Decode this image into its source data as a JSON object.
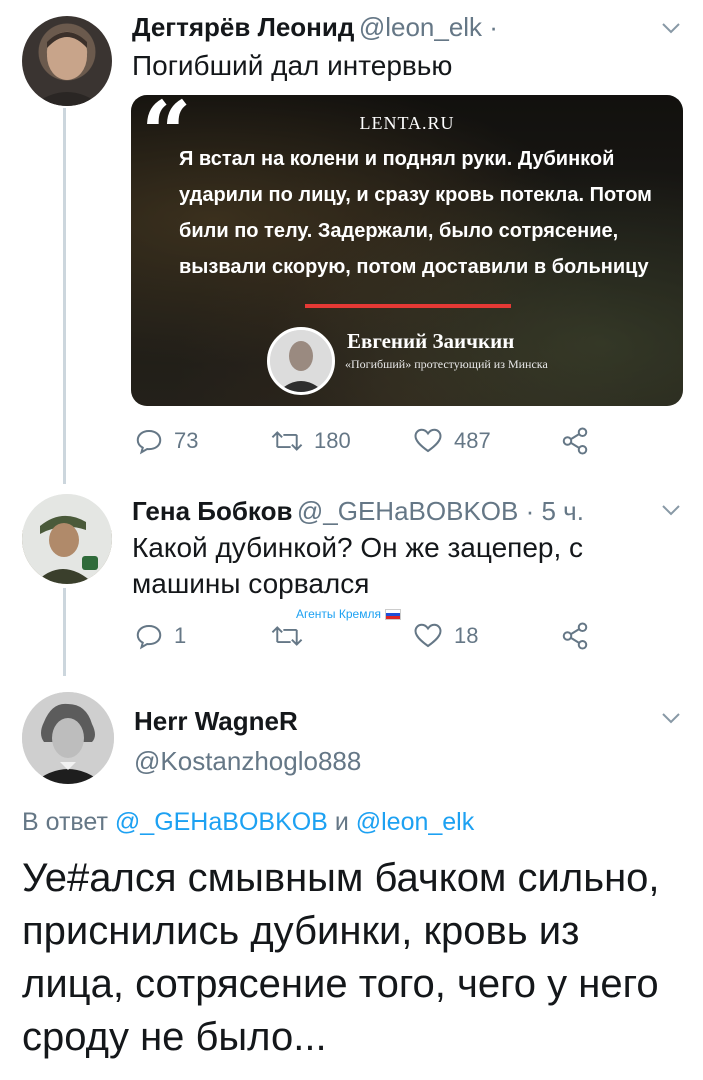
{
  "tweet1": {
    "author": "Дегтярёв Леонид",
    "handle": "@leon_elk ·",
    "text": "Погибший дал интервью",
    "card": {
      "brand": "LENTA.RU",
      "quote": "Я встал на колени и поднял руки. Дубинкой ударили по лицу, и сразу кровь потекла. Потом били по телу. Задержали, было сотрясение, вызвали скорую, потом доставили в больницу",
      "speaker_name": "Евгений Заичкин",
      "speaker_role": "«Погибший» протестующий из Минска"
    },
    "actions": {
      "replies": "73",
      "retweets": "180",
      "likes": "487"
    }
  },
  "tweet2": {
    "author": "Гена Бобков",
    "handle": "@_GEHaBOBKOB · 5 ч.",
    "text": "Какой дубинкой? Он же зацепер, с машины сорвался",
    "tag": "Агенты Кремля",
    "actions": {
      "replies": "1",
      "retweets": "",
      "likes": "18"
    }
  },
  "tweet3": {
    "author": "Herr WagneR",
    "handle": "@Kostanzhoglo888",
    "reply_prefix": "В ответ",
    "reply_mention1": "@_GEHaBOBKOB",
    "reply_and": "и",
    "reply_mention2": "@leon_elk",
    "text": "Уе#ался смывным бачком сильно, приснились дубинки, кровь из лица, сотрясение того, чего у него сроду не было..."
  },
  "icons": {
    "reply": "reply-icon",
    "retweet": "retweet-icon",
    "like": "heart-icon",
    "share": "share-icon",
    "menu": "chevron-down-icon"
  },
  "colors": {
    "text": "#14171a",
    "muted": "#657786",
    "accent": "#1da1f2",
    "line": "#ccd6dd"
  }
}
